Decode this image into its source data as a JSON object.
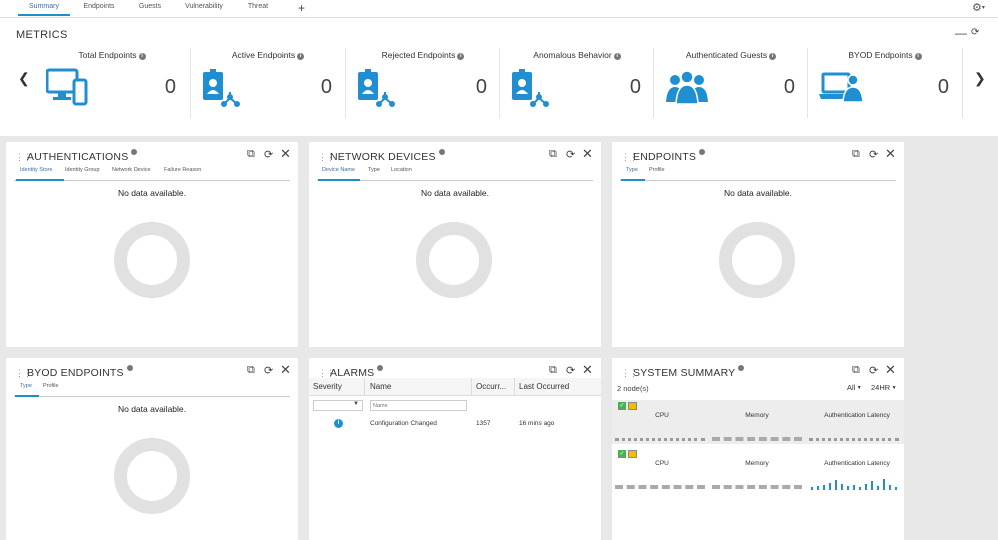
{
  "tabs": [
    {
      "label": "Summary",
      "active": true
    },
    {
      "label": "Endpoints",
      "active": false
    },
    {
      "label": "Guests",
      "active": false
    },
    {
      "label": "Vulnerability",
      "active": false
    },
    {
      "label": "Threat",
      "active": false
    }
  ],
  "add_tab_icon": "plus-icon",
  "settings_icon": "gear-icon",
  "metrics": {
    "title": "METRICS",
    "items": [
      {
        "label": "Total Endpoints",
        "value": "0",
        "icon": "monitor-tablet-icon"
      },
      {
        "label": "Active Endpoints",
        "value": "0",
        "icon": "badge-network-icon"
      },
      {
        "label": "Rejected Endpoints",
        "value": "0",
        "icon": "badge-network-icon"
      },
      {
        "label": "Anomalous Behavior",
        "value": "0",
        "icon": "badge-network-icon"
      },
      {
        "label": "Authenticated Guests",
        "value": "0",
        "icon": "users-group-icon"
      },
      {
        "label": "BYOD Endpoints",
        "value": "0",
        "icon": "laptop-user-icon"
      }
    ]
  },
  "dashlets": {
    "authentications": {
      "title": "AUTHENTICATIONS",
      "tabs": [
        "Identity Store",
        "Identity Group",
        "Network Device",
        "Failure Reason"
      ],
      "empty": "No data available."
    },
    "network_devices": {
      "title": "NETWORK DEVICES",
      "tabs": [
        "Device Name",
        "Type",
        "Location"
      ],
      "empty": "No data available."
    },
    "endpoints": {
      "title": "ENDPOINTS",
      "tabs": [
        "Type",
        "Profile"
      ],
      "empty": "No data available."
    },
    "byod_endpoints": {
      "title": "BYOD ENDPOINTS",
      "tabs": [
        "Type",
        "Profile"
      ],
      "empty": "No data available."
    },
    "alarms": {
      "title": "ALARMS",
      "columns": [
        "Severity",
        "Name",
        "Occurr...",
        "Last Occurred"
      ],
      "name_placeholder": "Name",
      "rows": [
        {
          "severity": "info",
          "name": "Configuration Changed",
          "occurrences": "1357",
          "last": "16 mins ago"
        }
      ]
    },
    "system_summary": {
      "title": "SYSTEM SUMMARY",
      "nodes_label": "2 node(s)",
      "filter_all": "All",
      "filter_time": "24HR",
      "columns": [
        "CPU",
        "Memory",
        "Authentication Latency"
      ]
    }
  },
  "colors": {
    "accent": "#1e90c8",
    "icon_blue": "#1f8fd1",
    "tab_active": "#3b6ea5"
  }
}
